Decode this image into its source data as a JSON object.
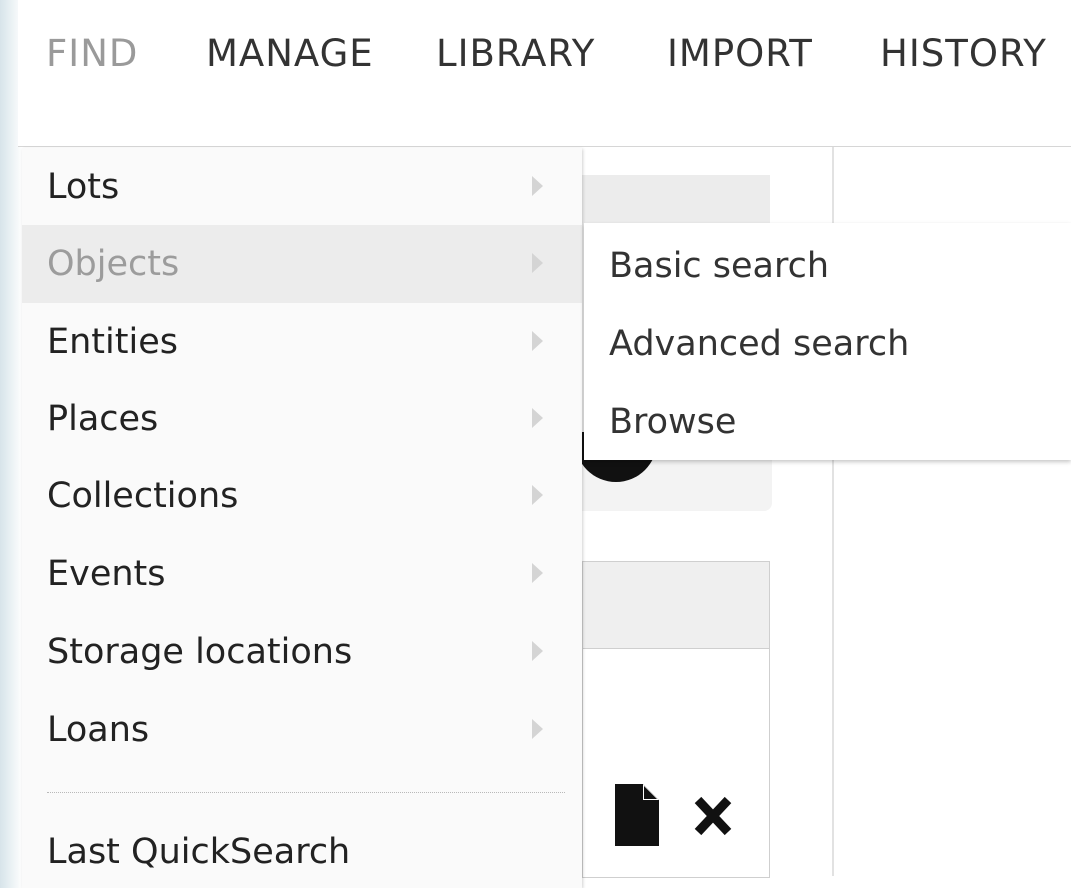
{
  "nav": {
    "items": [
      {
        "label": "FIND",
        "active": true
      },
      {
        "label": "MANAGE"
      },
      {
        "label": "LIBRARY"
      },
      {
        "label": "IMPORT"
      },
      {
        "label": "HISTORY"
      }
    ]
  },
  "find_menu": {
    "items": [
      {
        "label": "Lots"
      },
      {
        "label": "Objects",
        "highlighted": true
      },
      {
        "label": "Entities"
      },
      {
        "label": "Places"
      },
      {
        "label": "Collections"
      },
      {
        "label": "Events"
      },
      {
        "label": "Storage locations"
      },
      {
        "label": "Loans"
      }
    ],
    "last_item": "Last QuickSearch"
  },
  "objects_submenu": {
    "items": [
      {
        "label": "Basic search"
      },
      {
        "label": "Advanced search"
      },
      {
        "label": "Browse"
      }
    ]
  },
  "icons": [
    "caret-right-icon",
    "document-icon",
    "close-icon"
  ],
  "colors": {
    "nav_active": "#9a9a9a",
    "nav_text": "#333333",
    "menu_bg": "#fafafa",
    "menu_highlight": "#ececec"
  }
}
